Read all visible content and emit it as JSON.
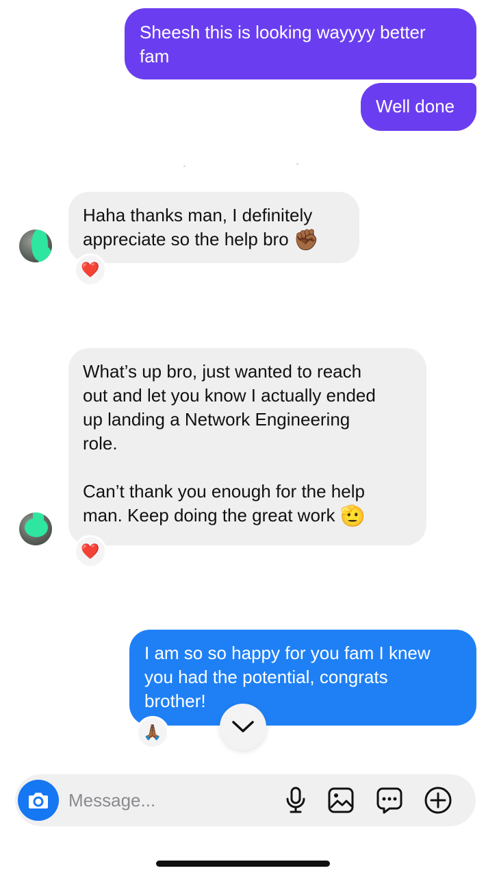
{
  "messages": [
    {
      "sender": "me",
      "text": "Sheesh this is looking wayyyy better\nfam"
    },
    {
      "sender": "me",
      "text": "Well done"
    },
    {
      "sender": "them",
      "text": "Haha thanks man, I definitely\nappreciate so the help bro",
      "emoji": "✊🏾",
      "reaction": "❤️"
    },
    {
      "sender": "them",
      "text": "What’s up bro, just wanted to reach\nout and let you know I actually ended\nup landing a Network Engineering\nrole.\n\nCan’t thank you enough for the help\nman. Keep doing the great work",
      "emoji": "🫡",
      "reaction": "❤️"
    },
    {
      "sender": "me",
      "text": "I am so so happy for you fam I knew\nyou had the potential, congrats\nbrother!",
      "reaction": "🙏🏾"
    }
  ],
  "composer": {
    "placeholder": "Message..."
  },
  "icons": {
    "camera": "camera-icon",
    "scroll_down": "chevron-down-icon",
    "mic": "microphone-icon",
    "gallery": "image-icon",
    "sticker": "chat-bubble-icon",
    "add": "plus-circle-icon"
  },
  "colors": {
    "sent_purple": "#6a3ef0",
    "sent_blue": "#1f80f5",
    "received": "#efeff0",
    "camera_button": "#1677f2"
  }
}
